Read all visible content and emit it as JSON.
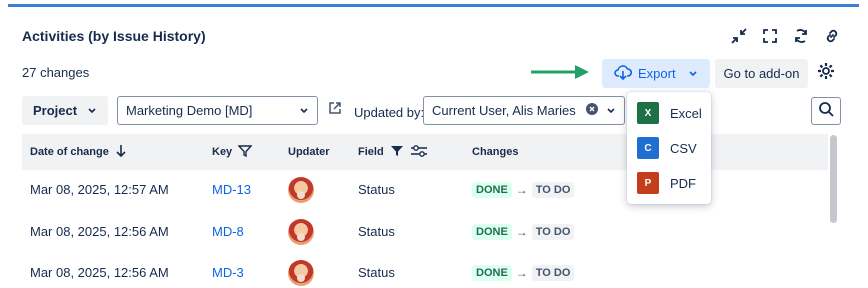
{
  "header": {
    "title": "Activities (by Issue History)",
    "icons": [
      "collapse-icon",
      "fullscreen-icon",
      "refresh-icon",
      "link-icon"
    ]
  },
  "toolbar": {
    "changes_count": "27 changes",
    "export_label": "Export",
    "addon_label": "Go to add-on"
  },
  "filters": {
    "project_label": "Project",
    "project_value": "Marketing Demo [MD]",
    "updated_by_label": "Updated by:",
    "updater_value": "Current User, Alis Maries"
  },
  "table": {
    "columns": {
      "date": "Date of change",
      "key": "Key",
      "updater": "Updater",
      "field": "Field",
      "changes": "Changes"
    },
    "rows": [
      {
        "date": "Mar 08, 2025, 12:57 AM",
        "key": "MD-13",
        "field": "Status",
        "from": "DONE",
        "to": "TO DO"
      },
      {
        "date": "Mar 08, 2025, 12:56 AM",
        "key": "MD-8",
        "field": "Status",
        "from": "DONE",
        "to": "TO DO"
      },
      {
        "date": "Mar 08, 2025, 12:56 AM",
        "key": "MD-3",
        "field": "Status",
        "from": "DONE",
        "to": "TO DO"
      }
    ]
  },
  "export_menu": {
    "items": [
      {
        "label": "Excel",
        "badge": "X",
        "color": "#1e7145"
      },
      {
        "label": "CSV",
        "badge": "C",
        "color": "#1f6fd1"
      },
      {
        "label": "PDF",
        "badge": "P",
        "color": "#c43e1c"
      }
    ]
  },
  "colors": {
    "accent": "#0c66e4",
    "annotation_arrow": "#22a06b"
  }
}
